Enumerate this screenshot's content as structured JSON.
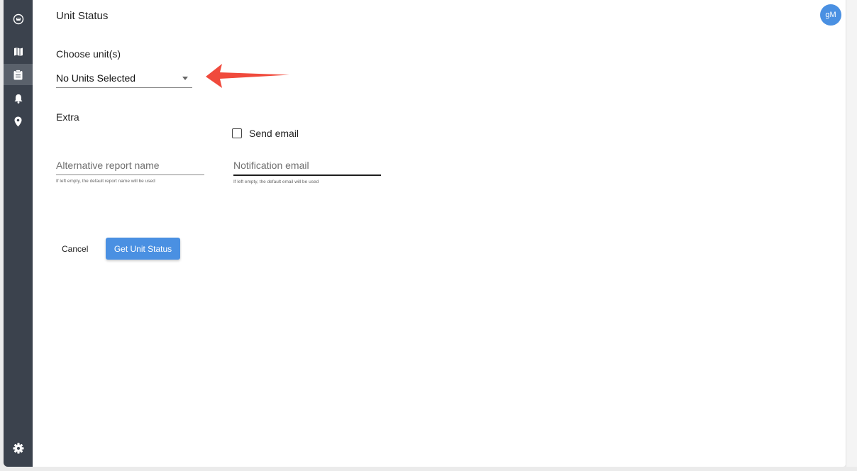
{
  "header": {
    "title": "Unit Status",
    "avatar_initials": "gM"
  },
  "sidebar": {
    "items": [
      {
        "icon": "vehicle-circle-icon",
        "active": false
      },
      {
        "icon": "map-icon",
        "active": false
      },
      {
        "icon": "clipboard-icon",
        "active": true
      },
      {
        "icon": "bell-icon",
        "active": false
      },
      {
        "icon": "location-pin-icon",
        "active": false
      }
    ],
    "bottom_icon": "gear-icon"
  },
  "form": {
    "units_label": "Choose unit(s)",
    "units_select_value": "No Units Selected",
    "extra_label": "Extra",
    "send_email_label": "Send email",
    "send_email_checked": false,
    "report_name": {
      "placeholder": "Alternative report name",
      "value": "",
      "helper": "If left empty, the default report name will be used"
    },
    "notification_email": {
      "placeholder": "Notification email",
      "value": "",
      "helper": "If left empty, the default email will be used"
    }
  },
  "actions": {
    "cancel_label": "Cancel",
    "submit_label": "Get Unit Status"
  },
  "colors": {
    "sidebar": "#3b424d",
    "primary": "#4a90e2",
    "annotation_arrow": "#f04a3c"
  }
}
